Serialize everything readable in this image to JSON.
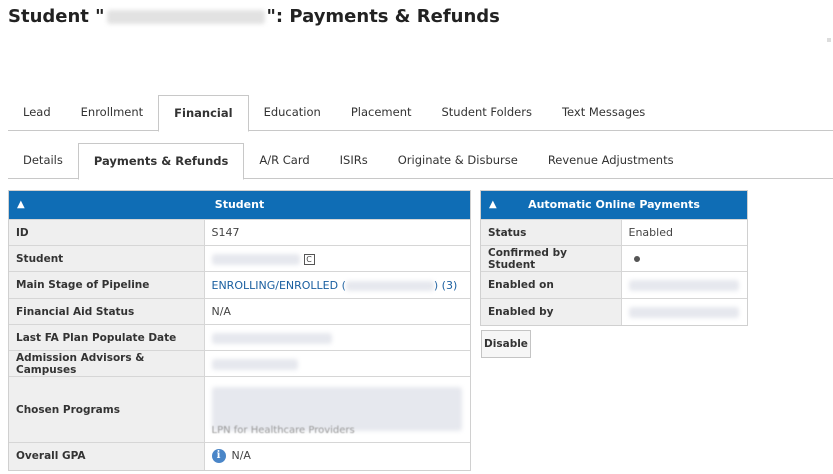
{
  "page": {
    "title_prefix": "Student \"",
    "title_suffix": "\": Payments & Refunds"
  },
  "top_tabs": [
    "Lead",
    "Enrollment",
    "Financial",
    "Education",
    "Placement",
    "Student Folders",
    "Text Messages"
  ],
  "top_tabs_active": "Financial",
  "sub_tabs": [
    "Details",
    "Payments & Refunds",
    "A/R Card",
    "ISIRs",
    "Originate & Disburse",
    "Revenue Adjustments"
  ],
  "sub_tabs_active": "Payments & Refunds",
  "student_panel": {
    "title": "Student",
    "caret": "▲",
    "rows": {
      "id_label": "ID",
      "id_value": "S147",
      "student_label": "Student",
      "c_icon": "C",
      "stage_label": "Main Stage of Pipeline",
      "stage_value_prefix": "ENROLLING/ENROLLED (",
      "stage_value_suffix": ") (3)",
      "fa_status_label": "Financial Aid Status",
      "fa_status_value": "N/A",
      "fa_plan_label": "Last FA Plan Populate Date",
      "advisors_label": "Admission Advisors & Campuses",
      "programs_label": "Chosen Programs",
      "programs_partial": "LPN for Healthcare Providers",
      "gpa_label": "Overall GPA",
      "gpa_value": "N/A"
    }
  },
  "payments_panel": {
    "title": "Automatic Online Payments",
    "caret": "▲",
    "status_label": "Status",
    "status_value": "Enabled",
    "confirmed_label": "Confirmed by Student",
    "enabled_on_label": "Enabled on",
    "enabled_by_label": "Enabled by"
  },
  "disable_button": "Disable",
  "icons": {
    "caret": "caret-up-icon",
    "info": "info-icon",
    "contact": "c-icon"
  },
  "colors": {
    "header_blue": "#0f6db5",
    "link_blue": "#1a5fa0"
  }
}
